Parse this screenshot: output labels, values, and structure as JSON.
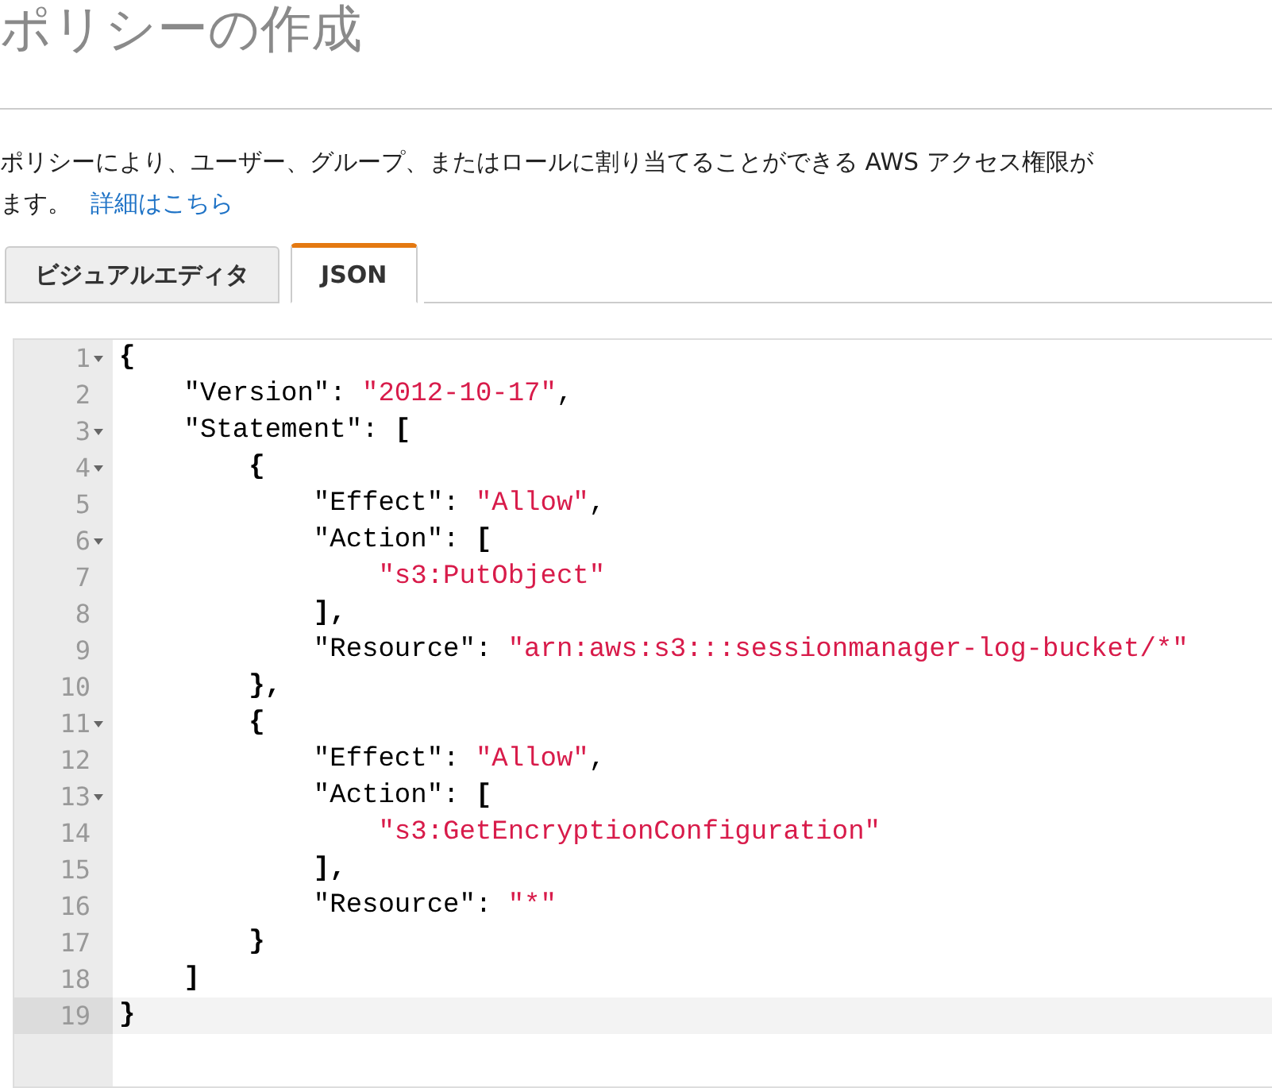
{
  "page_title": "ポリシーの作成",
  "description": {
    "text": "ポリシーにより、ユーザー、グループ、またはロールに割り当てることができる AWS アクセス権限が",
    "text_line2": "ます。",
    "link": "詳細はこちら"
  },
  "tabs": [
    {
      "label": "ビジュアルエディタ",
      "selected": false
    },
    {
      "label": "JSON",
      "selected": true
    }
  ],
  "editor": {
    "lines": [
      {
        "number": "1",
        "foldable": true,
        "active": false,
        "tokens": [
          {
            "kind": "punct",
            "text": "{"
          }
        ]
      },
      {
        "number": "2",
        "foldable": false,
        "active": false,
        "tokens": [
          {
            "kind": "key",
            "text": "    \"Version\": "
          },
          {
            "kind": "string",
            "text": "\"2012-10-17\""
          },
          {
            "kind": "key",
            "text": ","
          }
        ]
      },
      {
        "number": "3",
        "foldable": true,
        "active": false,
        "tokens": [
          {
            "kind": "key",
            "text": "    \"Statement\": "
          },
          {
            "kind": "punct",
            "text": "["
          }
        ]
      },
      {
        "number": "4",
        "foldable": true,
        "active": false,
        "tokens": [
          {
            "kind": "punct",
            "text": "        {"
          }
        ]
      },
      {
        "number": "5",
        "foldable": false,
        "active": false,
        "tokens": [
          {
            "kind": "key",
            "text": "            \"Effect\": "
          },
          {
            "kind": "string",
            "text": "\"Allow\""
          },
          {
            "kind": "key",
            "text": ","
          }
        ]
      },
      {
        "number": "6",
        "foldable": true,
        "active": false,
        "tokens": [
          {
            "kind": "key",
            "text": "            \"Action\": "
          },
          {
            "kind": "punct",
            "text": "["
          }
        ]
      },
      {
        "number": "7",
        "foldable": false,
        "active": false,
        "tokens": [
          {
            "kind": "string",
            "text": "                \"s3:PutObject\""
          }
        ]
      },
      {
        "number": "8",
        "foldable": false,
        "active": false,
        "tokens": [
          {
            "kind": "punct",
            "text": "            ],"
          }
        ]
      },
      {
        "number": "9",
        "foldable": false,
        "active": false,
        "tokens": [
          {
            "kind": "key",
            "text": "            \"Resource\": "
          },
          {
            "kind": "string",
            "text": "\"arn:aws:s3:::sessionmanager-log-bucket/*\""
          }
        ]
      },
      {
        "number": "10",
        "foldable": false,
        "active": false,
        "tokens": [
          {
            "kind": "punct",
            "text": "        },"
          }
        ]
      },
      {
        "number": "11",
        "foldable": true,
        "active": false,
        "tokens": [
          {
            "kind": "punct",
            "text": "        {"
          }
        ]
      },
      {
        "number": "12",
        "foldable": false,
        "active": false,
        "tokens": [
          {
            "kind": "key",
            "text": "            \"Effect\": "
          },
          {
            "kind": "string",
            "text": "\"Allow\""
          },
          {
            "kind": "key",
            "text": ","
          }
        ]
      },
      {
        "number": "13",
        "foldable": true,
        "active": false,
        "tokens": [
          {
            "kind": "key",
            "text": "            \"Action\": "
          },
          {
            "kind": "punct",
            "text": "["
          }
        ]
      },
      {
        "number": "14",
        "foldable": false,
        "active": false,
        "tokens": [
          {
            "kind": "string",
            "text": "                \"s3:GetEncryptionConfiguration\""
          }
        ]
      },
      {
        "number": "15",
        "foldable": false,
        "active": false,
        "tokens": [
          {
            "kind": "punct",
            "text": "            ],"
          }
        ]
      },
      {
        "number": "16",
        "foldable": false,
        "active": false,
        "tokens": [
          {
            "kind": "key",
            "text": "            \"Resource\": "
          },
          {
            "kind": "string",
            "text": "\"*\""
          }
        ]
      },
      {
        "number": "17",
        "foldable": false,
        "active": false,
        "tokens": [
          {
            "kind": "punct",
            "text": "        }"
          }
        ]
      },
      {
        "number": "18",
        "foldable": false,
        "active": false,
        "tokens": [
          {
            "kind": "punct",
            "text": "    ]"
          }
        ]
      },
      {
        "number": "19",
        "foldable": false,
        "active": true,
        "tokens": [
          {
            "kind": "punct",
            "text": "}"
          }
        ]
      }
    ]
  }
}
